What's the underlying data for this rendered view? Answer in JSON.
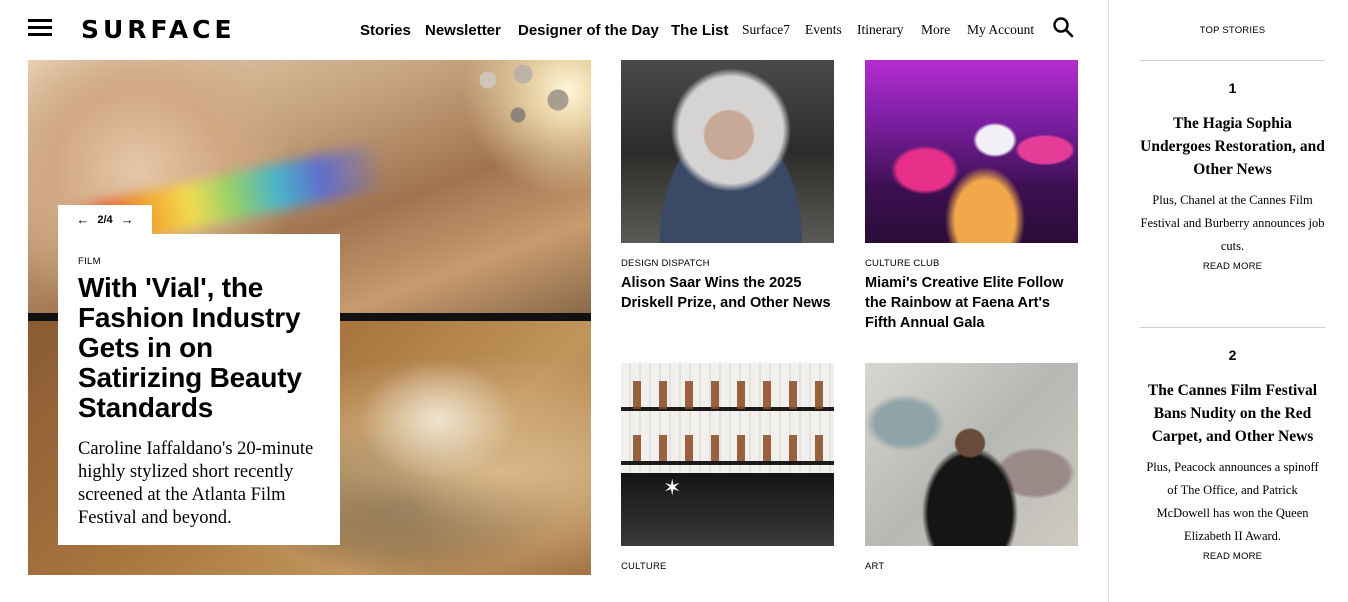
{
  "header": {
    "logo": "SURFACE",
    "nav": [
      {
        "label": "Stories",
        "style": "bold"
      },
      {
        "label": "Newsletter",
        "style": "bold"
      },
      {
        "label": "Designer of the Day",
        "style": "bold"
      },
      {
        "label": "The List",
        "style": "bold"
      },
      {
        "label": "Surface7",
        "style": "serif"
      },
      {
        "label": "Events",
        "style": "serif"
      },
      {
        "label": "Itinerary",
        "style": "serif"
      },
      {
        "label": "More",
        "style": "serif"
      },
      {
        "label": "My Account",
        "style": "serif"
      }
    ],
    "menu_icon": "hamburger-menu-icon",
    "search_icon": "search-icon"
  },
  "hero": {
    "slider": {
      "current": "2",
      "separator": "/",
      "total": "4",
      "prev_icon": "arrow-left-icon",
      "next_icon": "arrow-right-icon"
    },
    "category": "FILM",
    "title": "With 'Vial', the Fashion Industry Gets in on Satirizing Beauty Standards",
    "summary": "Caroline Iaffaldano's 20-minute highly stylized short recently screened at the Atlanta Film Festival and beyond."
  },
  "articles": [
    {
      "category": "DESIGN DISPATCH",
      "title": "Alison Saar Wins the 2025 Driskell Prize, and Other News"
    },
    {
      "category": "CULTURE CLUB",
      "title": "Miami's Creative Elite Follow the Rainbow at Faena Art's Fifth Annual Gala"
    },
    {
      "category": "CULTURE",
      "title": ""
    },
    {
      "category": "ART",
      "title": ""
    }
  ],
  "sidebar": {
    "title": "TOP STORIES",
    "stories": [
      {
        "number": "1",
        "title": "The Hagia Sophia Undergoes Restoration, and Other News",
        "summary": "Plus, Chanel at the Cannes Film Festival and Burberry announces job cuts.",
        "read_more": "READ MORE"
      },
      {
        "number": "2",
        "title": "The Cannes Film Festival Bans Nudity on the Red Carpet, and Other News",
        "summary": "Plus, Peacock announces a spinoff of The Office, and Patrick McDowell has won the Queen Elizabeth II Award.",
        "read_more": "READ MORE"
      }
    ]
  }
}
